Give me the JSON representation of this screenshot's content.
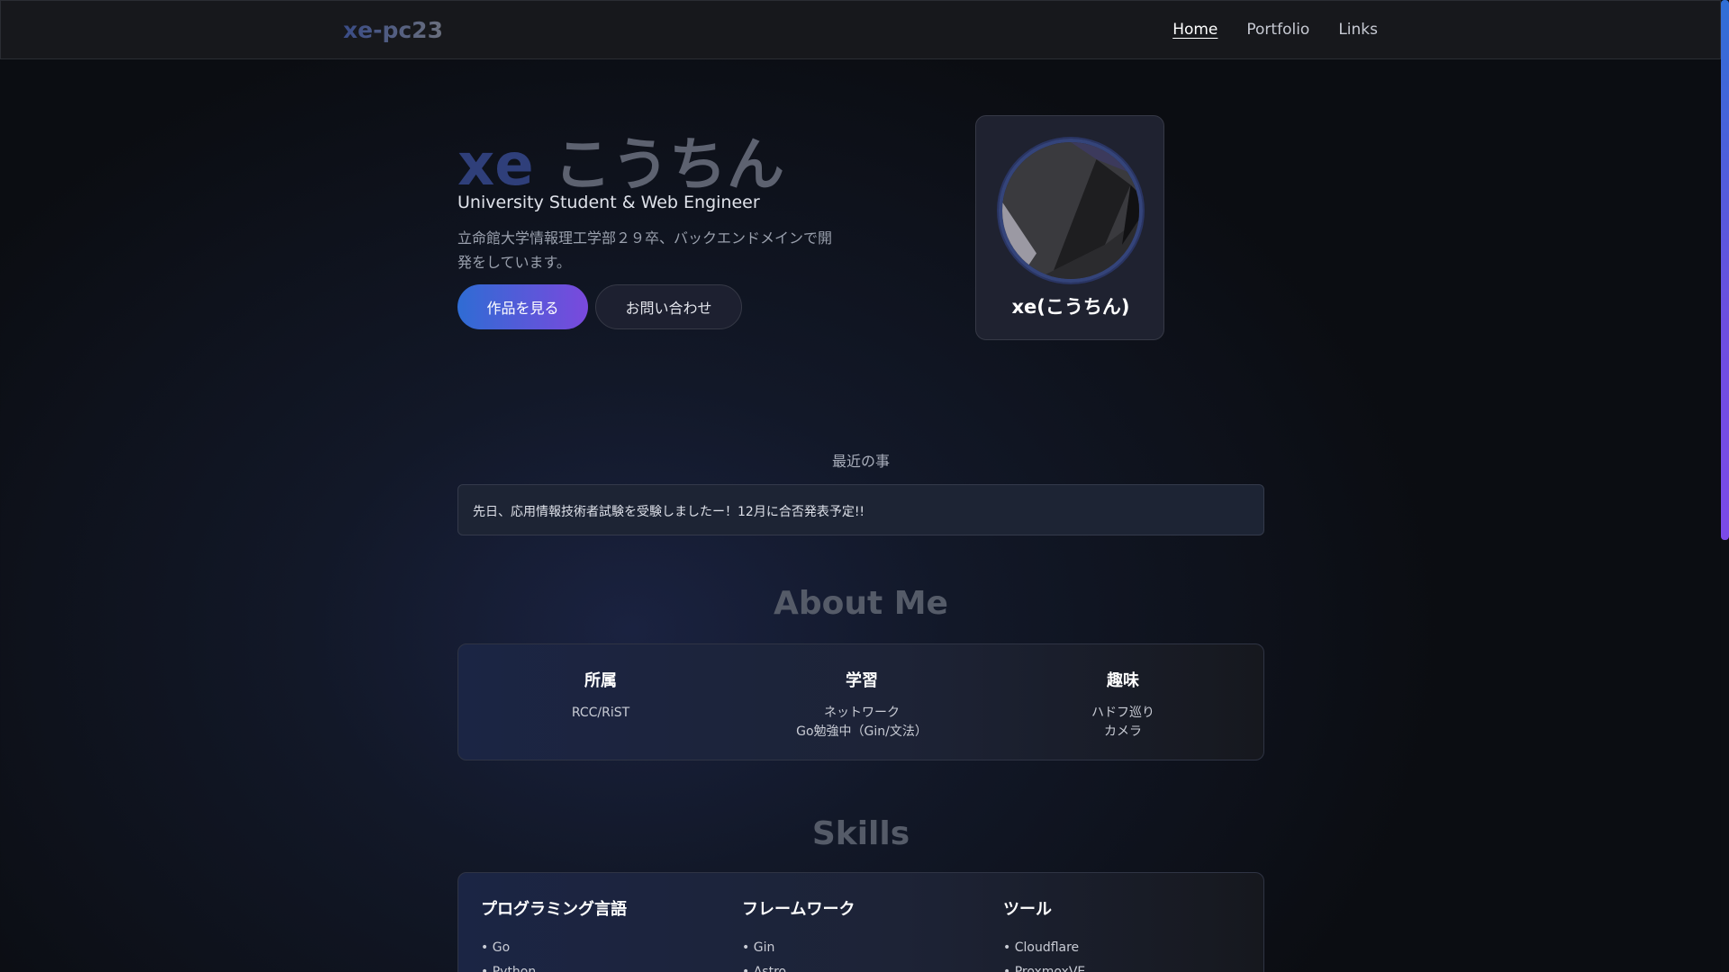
{
  "header": {
    "brand": "xe-pc23",
    "nav": [
      "Home",
      "Portfolio",
      "Links"
    ]
  },
  "hero": {
    "name_first": "xe",
    "name_last": "こうちん",
    "role": "University Student & Web Engineer",
    "description": "立命館大学情報理工学部２９卒、バックエンドメインで開発をしています。",
    "primary_button": "作品を見る",
    "secondary_button": "お問い合わせ"
  },
  "profile": {
    "name": "xe(こうちん)",
    "avatar_icon": "avatar-image"
  },
  "recent": {
    "heading": "最近の事",
    "text": "先日、応用情報技術者試験を受験しましたー！12月に合否発表予定!!"
  },
  "about": {
    "title": "About Me",
    "columns": [
      {
        "title": "所属",
        "lines": [
          "RCC/RiST"
        ]
      },
      {
        "title": "学習",
        "lines": [
          "ネットワーク",
          "Go勉強中（Gin/文法）"
        ]
      },
      {
        "title": "趣味",
        "lines": [
          "ハドフ巡り",
          "カメラ"
        ]
      }
    ]
  },
  "skills": {
    "title": "Skills",
    "columns": [
      {
        "title": "プログラミング言語",
        "items": [
          "Go",
          "Python"
        ]
      },
      {
        "title": "フレームワーク",
        "items": [
          "Gin",
          "Astro"
        ]
      },
      {
        "title": "ツール",
        "items": [
          "Cloudflare",
          "ProxmoxVE"
        ]
      }
    ]
  },
  "colors": {
    "accent_blue": "#2f6cd4",
    "accent_purple": "#7a49dd",
    "background": "#0b0d12"
  }
}
